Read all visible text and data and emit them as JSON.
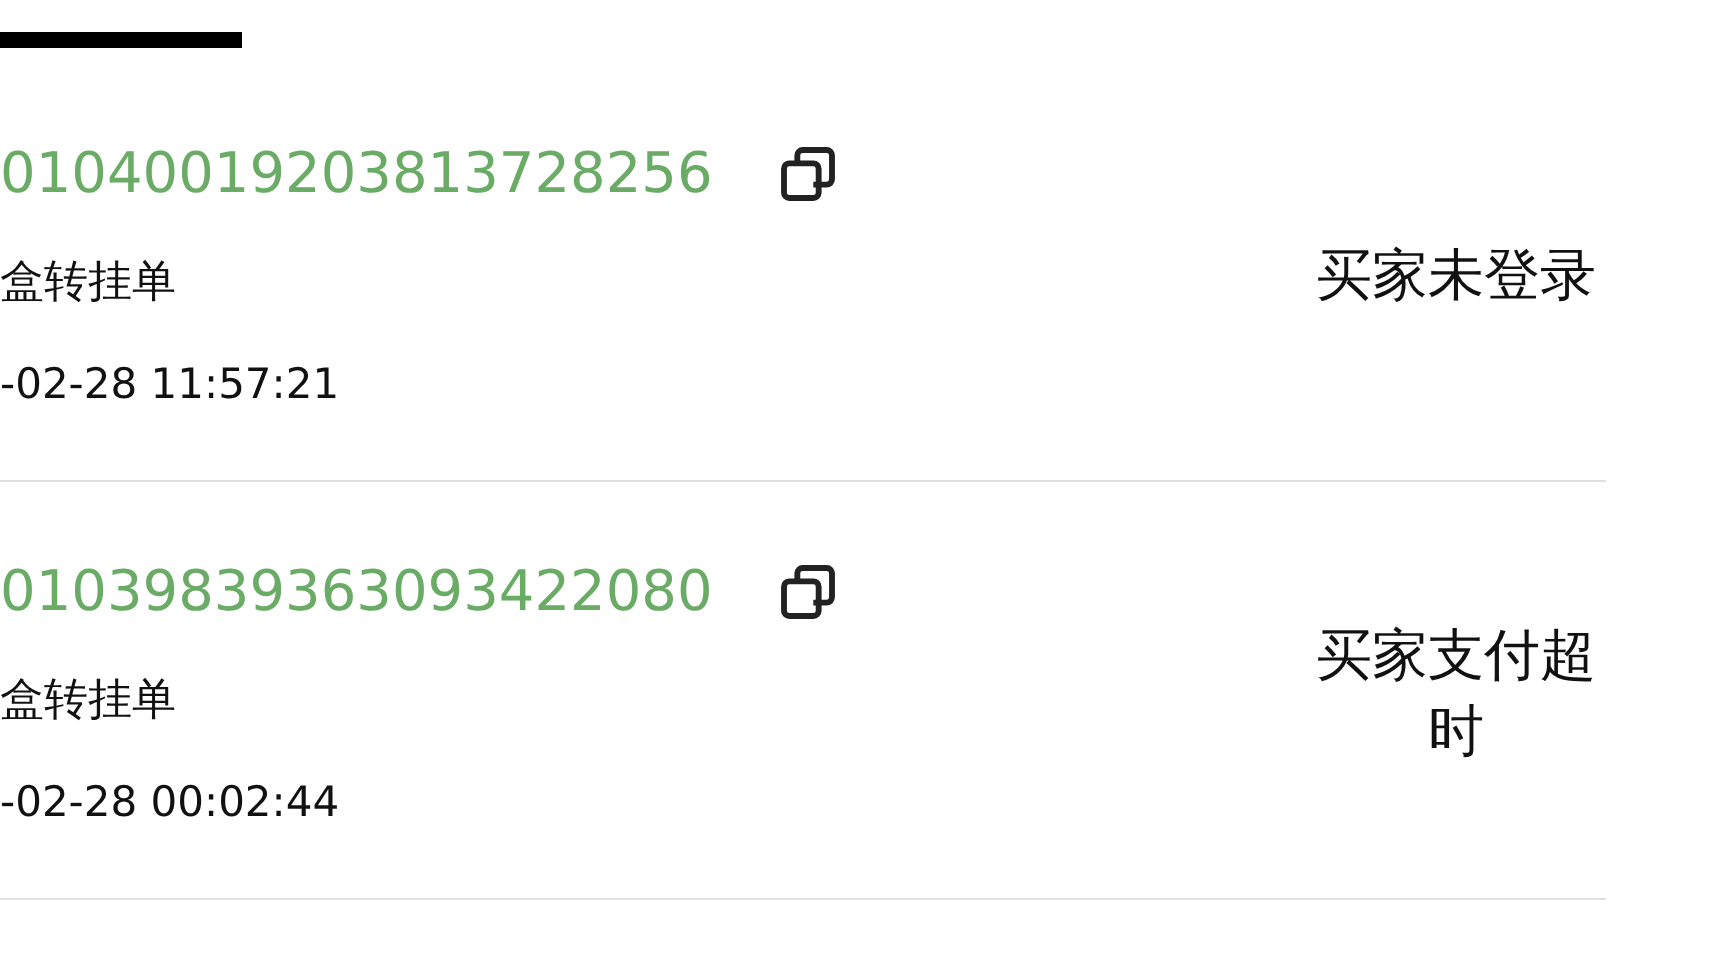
{
  "orders": [
    {
      "order_no": "01040019203813728256",
      "type": "盒转挂单",
      "time": "-02-28 11:57:21",
      "status": "买家未登录"
    },
    {
      "order_no": "01039839363093422080",
      "type": "盒转挂单",
      "time": "-02-28 00:02:44",
      "status": "买家支付超时"
    }
  ]
}
